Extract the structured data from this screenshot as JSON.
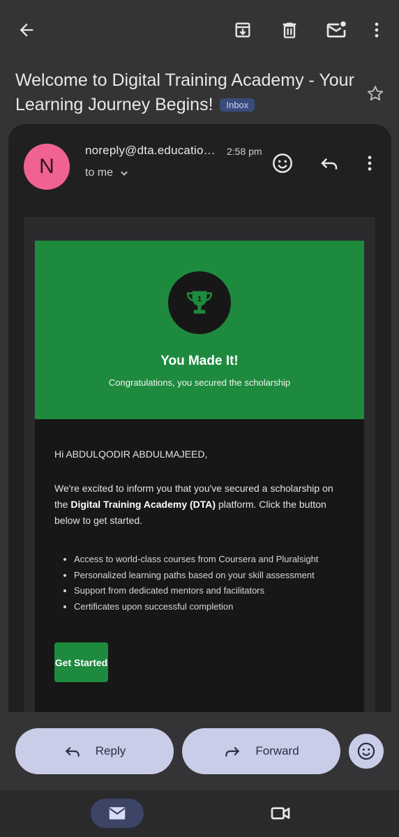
{
  "toolbar": {
    "back_icon": "arrow-back-icon",
    "archive_icon": "archive-icon",
    "delete_icon": "delete-icon",
    "mark_unread_icon": "mark-unread-icon",
    "more_icon": "more-vert-icon"
  },
  "email": {
    "subject": "Welcome to Digital Training Academy - Your Learning Journey Begins!",
    "label": "Inbox",
    "starred": false,
    "sender_initial": "N",
    "sender": "noreply@dta.educatio…",
    "time": "2:58 pm",
    "recipient": "to me",
    "avatar_color": "#f06292"
  },
  "message": {
    "hero_title": "You Made It!",
    "hero_subtitle": "Congratulations, you secured the scholarship",
    "trophy_number": "1",
    "greeting": "Hi ABDULQODIR ABDULMAJEED,",
    "para_before": "We're excited to inform you that you've secured a scholarship on the ",
    "para_bold": "Digital Training Academy (DTA)",
    "para_after": " platform. Click the button below to get started.",
    "bullets": [
      "Access to world-class courses from Coursera and Pluralsight",
      "Personalized learning paths based on your skill assessment",
      "Support from dedicated mentors and facilitators",
      "Certificates upon successful completion"
    ],
    "cta_label": "Get Started",
    "brand_color": "#1e8a3e"
  },
  "actions": {
    "reply_label": "Reply",
    "forward_label": "Forward"
  }
}
